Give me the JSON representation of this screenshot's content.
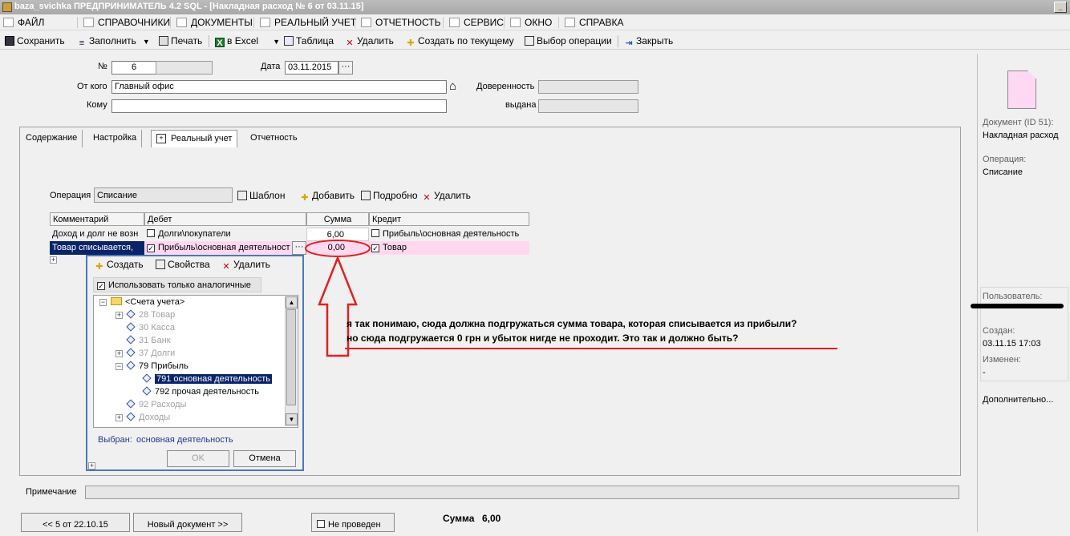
{
  "window": {
    "title": "baza_svichka ПРЕДПРИНИМАТЕЛЬ 4.2 SQL - [Накладная расход № 6 от 03.11.15]"
  },
  "menu": [
    {
      "label": "ФАЙЛ",
      "icon": "file-icon"
    },
    {
      "label": "СПРАВОЧНИКИ",
      "icon": "book-icon"
    },
    {
      "label": "ДОКУМЕНТЫ",
      "icon": "document-icon"
    },
    {
      "label": "РЕАЛЬНЫЙ УЧЕТ",
      "icon": "ledger-icon"
    },
    {
      "label": "ОТЧЕТНОСТЬ",
      "icon": "report-icon"
    },
    {
      "label": "СЕРВИС",
      "icon": "service-icon"
    },
    {
      "label": "ОКНО",
      "icon": "window-icon"
    },
    {
      "label": "СПРАВКА",
      "icon": "help-icon"
    }
  ],
  "toolbar": {
    "save": "Сохранить",
    "fill": "Заполнить",
    "print": "Печать",
    "excel": "в Excel",
    "table": "Таблица",
    "delete": "Удалить",
    "create_from": "Создать по текущему",
    "choose_op": "Выбор операции",
    "close": "Закрыть"
  },
  "header": {
    "num_label": "№",
    "num_value": "6",
    "date_label": "Дата",
    "date_value": "03.11.2015",
    "from_label": "От кого",
    "from_value": "Главный офис",
    "to_label": "Кому",
    "to_value": "",
    "proxy_label": "Доверенность",
    "issued_label": "выдана"
  },
  "tabs": [
    "Содержание",
    "Настройка",
    "Реальный учет",
    "Отчетность"
  ],
  "operation": {
    "label": "Операция",
    "value": "Списание",
    "template": "Шаблон",
    "add": "Добавить",
    "details": "Подробно",
    "delete": "Удалить"
  },
  "grid": {
    "columns": [
      "Комментарий",
      "Дебет",
      "Сумма",
      "Кредит"
    ],
    "rows": [
      {
        "comment": "Доход и долг не возн",
        "debit": "Долги\\покупатели",
        "debit_checked": false,
        "sum": "6,00",
        "credit": "Прибыль\\основная деятельность",
        "credit_checked": false
      },
      {
        "comment": "Товар списывается,",
        "debit": "Прибыль\\основная деятельност",
        "debit_checked": true,
        "sum": "0,00",
        "credit": "Товар",
        "credit_checked": true
      }
    ]
  },
  "popup": {
    "create": "Создать",
    "properties": "Свойства",
    "delete": "Удалить",
    "only_similar": "Использовать только аналогичные",
    "tree": [
      {
        "label": "<Счета учета>",
        "type": "root"
      },
      {
        "label": "28 Товар",
        "disabled": true
      },
      {
        "label": "30 Касса",
        "disabled": true
      },
      {
        "label": "31 Банк",
        "disabled": true
      },
      {
        "label": "37 Долги",
        "disabled": true
      },
      {
        "label": "79 Прибыль",
        "disabled": false
      },
      {
        "label": "791 основная деятельность",
        "selected": true
      },
      {
        "label": "792 прочая деятельность",
        "disabled": false
      },
      {
        "label": "92 Расходы",
        "disabled": true
      },
      {
        "label": "Доходы",
        "disabled": true
      }
    ],
    "selected_label": "Выбран:",
    "selected_value": "основная деятельность",
    "ok": "OK",
    "cancel": "Отмена"
  },
  "annotation": {
    "line1": "я так понимаю, сюда должна подгружаться сумма товара, которая списывается из прибыли?",
    "line2": "но сюда подгружается 0 грн и убыток нигде не проходит. Это так и должно быть?"
  },
  "note_label": "Примечание",
  "bottom": {
    "prev": "<< 5 от 22.10.15",
    "new_doc": "Новый документ >>",
    "not_posted": "Не проведен",
    "sum_label": "Сумма",
    "sum_value": "6,00"
  },
  "right": {
    "doc_label": "Документ (ID 51):",
    "doc_value": "Накладная расход",
    "op_label": "Операция:",
    "op_value": "Списание",
    "user_label": "Пользователь:",
    "created_label": "Создан:",
    "created_value": "03.11.15  17:03",
    "changed_label": "Изменен:",
    "changed_value": "-",
    "more": "Дополнительно..."
  },
  "colors": {
    "selection": "#0a246a",
    "annotation": "#e02020",
    "pink": "#ffd8f0"
  }
}
